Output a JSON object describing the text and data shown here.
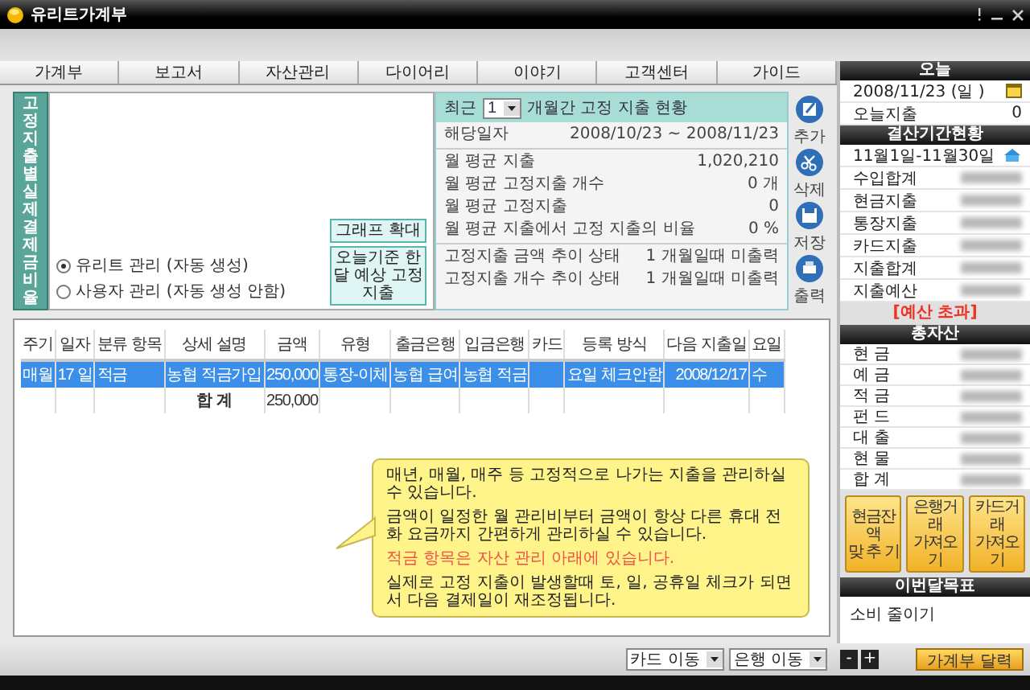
{
  "window": {
    "title": "유리트가계부"
  },
  "tabs": [
    {
      "label": "가계부"
    },
    {
      "label": "보고서"
    },
    {
      "label": "자산관리"
    },
    {
      "label": "다이어리"
    },
    {
      "label": "이야기"
    },
    {
      "label": "고객센터"
    },
    {
      "label": "가이드"
    }
  ],
  "fixed_expense_chart": {
    "side_title": "고정지출별 실제 결제금 비율",
    "modes": [
      {
        "label": "유리트 관리 (자동 생성)",
        "selected": true
      },
      {
        "label": "사용자 관리 (자동 생성 안함)",
        "selected": false
      }
    ],
    "buttons": [
      "그래프 확대",
      "오늘기준 한달 예상 고정지출"
    ]
  },
  "summary": {
    "prefix": "최근",
    "months": "1",
    "suffix": "개월간 고정 지출 현황",
    "sections": [
      {
        "rows": [
          {
            "label": "해당일자",
            "value": "2008/10/23 ~ 2008/11/23"
          }
        ]
      },
      {
        "rows": [
          {
            "label": "월 평균 지출",
            "value": "1,020,210"
          },
          {
            "label": "월 평균 고정지출 개수",
            "value": "0 개"
          },
          {
            "label": "월 평균 고정지출",
            "value": "0"
          },
          {
            "label": "월 평균 지출에서 고정 지출의 비율",
            "value": "0 %"
          }
        ]
      },
      {
        "rows": [
          {
            "label": "고정지출 금액 추이 상태",
            "value": "1 개월일때 미출력"
          },
          {
            "label": "고정지출 개수 추이 상태",
            "value": "1 개월일때 미출력"
          }
        ]
      }
    ]
  },
  "actions": [
    {
      "kind": "add",
      "label": "추가"
    },
    {
      "kind": "delete",
      "label": "삭제"
    },
    {
      "kind": "save",
      "label": "저장"
    },
    {
      "kind": "print",
      "label": "출력"
    }
  ],
  "table": {
    "columns": [
      "주기",
      "일자",
      "분류 항목",
      "상세 설명",
      "금액",
      "유형",
      "출금은행",
      "입금은행",
      "카드",
      "등록 방식",
      "다음 지출일",
      "요일"
    ],
    "rows": [
      {
        "selected": true,
        "cells": [
          "매월",
          "17 일",
          "적금",
          "농협 적금가입",
          "250,000",
          "통장-이체",
          "농협 급여",
          "농협 적금",
          "",
          "요일 체크안함",
          "2008/12/17",
          "수"
        ]
      }
    ],
    "total": {
      "label": "합 계",
      "amount": "250,000"
    }
  },
  "tip": {
    "paragraphs": [
      {
        "kind": "normal",
        "text": "매년, 매월, 매주 등 고정적으로 나가는 지출을 관리하실 수 있습니다."
      },
      {
        "kind": "normal",
        "text": "금액이 일정한 월 관리비부터 금액이 항상 다른 휴대 전화 요금까지 간편하게 관리하실 수 있습니다."
      },
      {
        "kind": "warning",
        "text": "적금 항목은 자산 관리 아래에 있습니다."
      },
      {
        "kind": "normal",
        "text": "실제로 고정 지출이 발생할때 토, 일, 공휴일 체크가 되면서 다음 결제일이 재조정됩니다."
      }
    ]
  },
  "sidebar": {
    "today": {
      "title": "오늘",
      "date": "2008/11/23 (일 )",
      "spent_label": "오늘지출",
      "spent": "0"
    },
    "period": {
      "title": "결산기간현황",
      "range": "11월1일-11월30일",
      "rows": [
        "수입합계",
        "현금지출",
        "통장지출",
        "카드지출",
        "지출합계",
        "지출예산"
      ],
      "status": "[예산 초과]"
    },
    "assets": {
      "title": "총자산",
      "rows": [
        "현 금",
        "예 금",
        "적 금",
        "펀 드",
        "대 출",
        "현 물",
        "합 계"
      ],
      "buttons": [
        "현금잔액\n맞 추 기",
        "은행거래\n가져오기",
        "카드거래\n가져오기"
      ]
    },
    "goal": {
      "title": "이번달목표",
      "text": "소비 줄이기"
    }
  },
  "bottom_bar": {
    "selects": [
      "카드 이동",
      "은행 이동"
    ],
    "zoom_buttons": [
      "-",
      "+"
    ],
    "calendar_button": "가계부 달력"
  }
}
